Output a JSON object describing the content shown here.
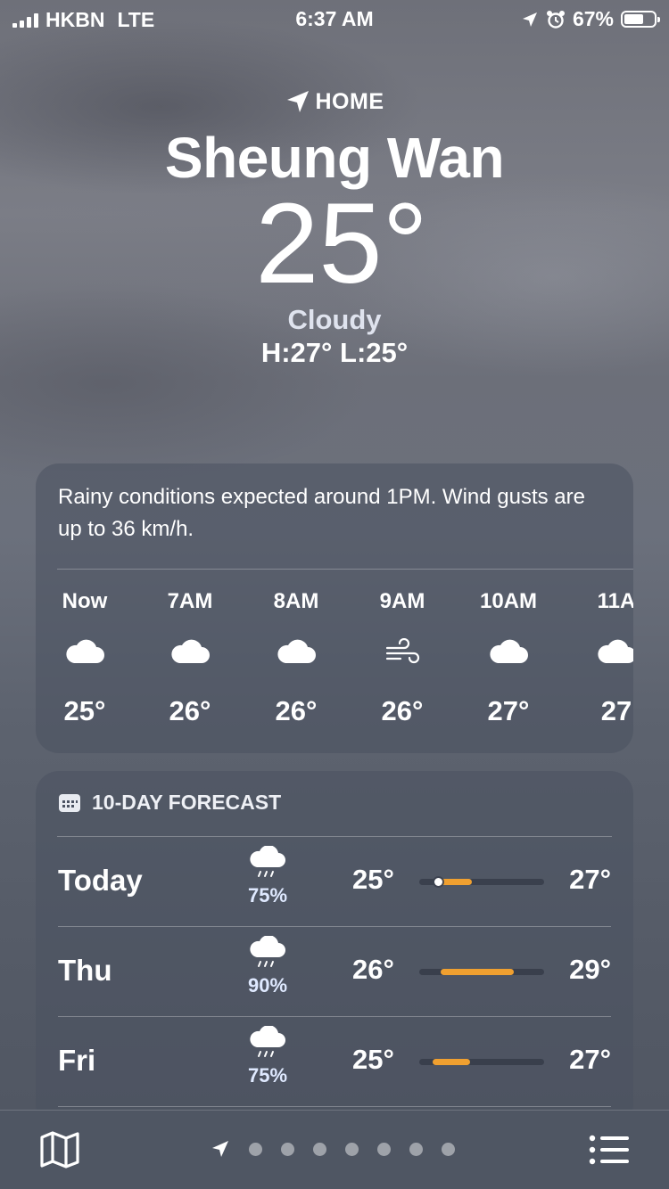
{
  "status_bar": {
    "carrier": "HKBN",
    "network": "LTE",
    "time": "6:37 AM",
    "battery": "67%",
    "battery_level": 0.67
  },
  "header": {
    "home_label": "HOME",
    "city": "Sheung Wan",
    "temperature": "25°",
    "condition": "Cloudy",
    "high_low": "H:27°  L:25°"
  },
  "hourly_card": {
    "summary": "Rainy conditions expected around 1PM. Wind gusts are up to 36 km/h.",
    "hours": [
      {
        "label": "Now",
        "icon": "cloud-icon",
        "temp": "25°"
      },
      {
        "label": "7AM",
        "icon": "cloud-icon",
        "temp": "26°"
      },
      {
        "label": "8AM",
        "icon": "cloud-icon",
        "temp": "26°"
      },
      {
        "label": "9AM",
        "icon": "wind-icon",
        "temp": "26°"
      },
      {
        "label": "10AM",
        "icon": "cloud-icon",
        "temp": "27°"
      },
      {
        "label": "11A",
        "icon": "cloud-icon",
        "temp": "27"
      }
    ]
  },
  "forecast_card": {
    "title": "10-DAY FORECAST",
    "days": [
      {
        "day": "Today",
        "icon": "cloud-rain-icon",
        "precip": "75%",
        "low": "25°",
        "high": "27°",
        "bar_start": 0.15,
        "bar_end": 0.42,
        "current_marker": 0.12
      },
      {
        "day": "Thu",
        "icon": "cloud-rain-icon",
        "precip": "90%",
        "low": "26°",
        "high": "29°",
        "bar_start": 0.17,
        "bar_end": 0.76
      },
      {
        "day": "Fri",
        "icon": "cloud-rain-icon",
        "precip": "75%",
        "low": "25°",
        "high": "27°",
        "bar_start": 0.11,
        "bar_end": 0.41
      }
    ]
  },
  "tab_bar": {
    "map_icon": "map-icon",
    "list_icon": "list-icon",
    "page_count": 7
  },
  "colors": {
    "accent_bar": "#f0a030",
    "card_bg": "rgba(74,82,96,0.55)"
  }
}
